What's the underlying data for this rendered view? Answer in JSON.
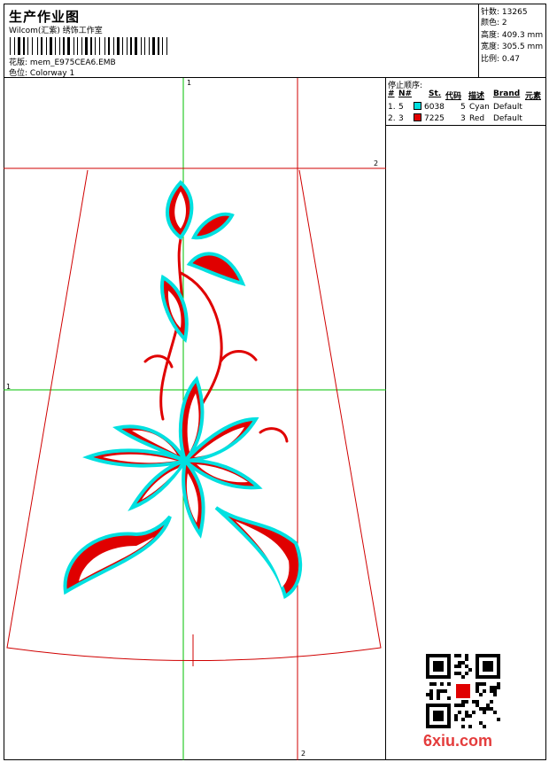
{
  "header": {
    "title": "生产作业图",
    "subtitle": "Wilcom(汇紫) 绣饰工作室",
    "design_label": "花版:",
    "design_value": "mem_E975CEA6.EMB",
    "colorway_label": "色位:",
    "colorway_value": "Colorway 1"
  },
  "stats": [
    {
      "label": "针数:",
      "value": "13265"
    },
    {
      "label": "颜色:",
      "value": "2"
    },
    {
      "label": "高度:",
      "value": "409.3 mm"
    },
    {
      "label": "宽度:",
      "value": "305.5 mm"
    },
    {
      "label": "比例:",
      "value": "0.47"
    }
  ],
  "stop_sequence": {
    "heading": "停止顺序:",
    "columns": [
      "#",
      "N#",
      "St.",
      "代码",
      "描述",
      "Brand",
      "元素"
    ],
    "rows": [
      {
        "index": "1.",
        "needle": "5",
        "code_num": "6038",
        "stitches": "5",
        "desc": "Cyan",
        "brand": "Default",
        "color": "#00e0e0"
      },
      {
        "index": "2.",
        "needle": "3",
        "code_num": "7225",
        "stitches": "3",
        "desc": "Red",
        "brand": "Default",
        "color": "#e00000"
      }
    ]
  },
  "markers": {
    "top": "1",
    "left": "1",
    "right": "2",
    "bottom": "2"
  },
  "watermark": "6xiu.com",
  "colors": {
    "guide_green": "#00c000",
    "guide_red": "#d00000",
    "thread_cyan": "#00e0e0",
    "thread_red": "#e00000"
  }
}
